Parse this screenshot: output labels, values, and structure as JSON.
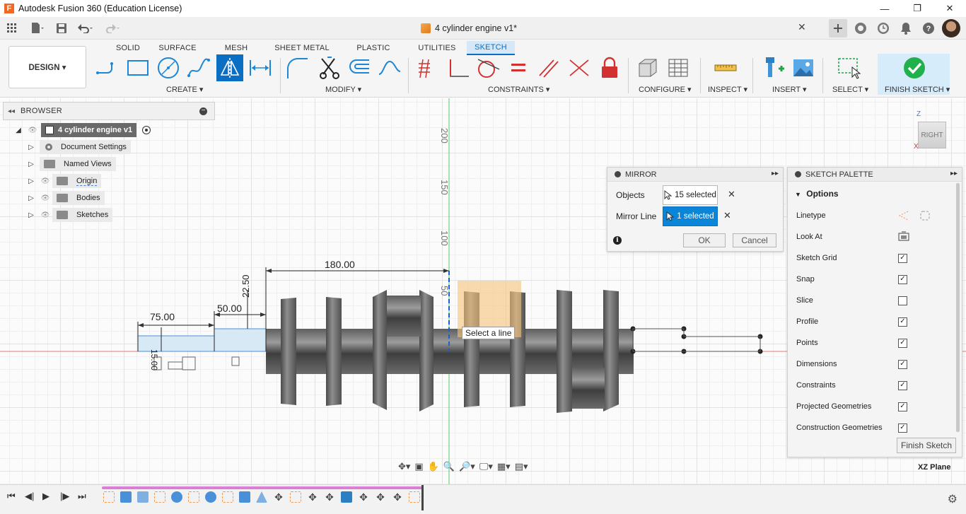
{
  "window": {
    "title": "Autodesk Fusion 360 (Education License)",
    "minimize": "—",
    "restore": "❐",
    "close": "✕"
  },
  "document": {
    "tab_title": "4 cylinder engine v1*",
    "close": "✕"
  },
  "workspace": {
    "design_label": "DESIGN ▾"
  },
  "ribbon": {
    "tabs": [
      {
        "label": "SOLID"
      },
      {
        "label": "SURFACE"
      },
      {
        "label": "MESH"
      },
      {
        "label": "SHEET METAL"
      },
      {
        "label": "PLASTIC"
      },
      {
        "label": "UTILITIES"
      },
      {
        "label": "SKETCH",
        "active": true
      }
    ],
    "groups": {
      "create": "CREATE ▾",
      "modify": "MODIFY ▾",
      "constraints": "CONSTRAINTS ▾",
      "configure": "CONFIGURE ▾",
      "inspect": "INSPECT ▾",
      "insert": "INSERT ▾",
      "select": "SELECT ▾",
      "finish_sketch": "FINISH SKETCH ▾"
    }
  },
  "browser": {
    "title": "BROWSER",
    "root": "4 cylinder engine v1",
    "items": [
      {
        "label": "Document Settings",
        "icon": "gear-icon"
      },
      {
        "label": "Named Views",
        "icon": "folder-icon"
      },
      {
        "label": "Origin",
        "icon": "folder-icon"
      },
      {
        "label": "Bodies",
        "icon": "folder-icon"
      },
      {
        "label": "Sketches",
        "icon": "folder-icon"
      }
    ]
  },
  "sketch": {
    "dimensions": {
      "d180": "180.00",
      "d75": "75.00",
      "d50": "50.00",
      "d22": "22.50",
      "d15": "15.00",
      "d200": "200",
      "d150": "150",
      "d100": "100",
      "d50v": "50"
    },
    "tooltip": "Select a line"
  },
  "mirror": {
    "title": "MIRROR",
    "objects_label": "Objects",
    "objects_value": "15 selected",
    "mirror_line_label": "Mirror Line",
    "mirror_line_value": "1 selected",
    "ok": "OK",
    "cancel": "Cancel"
  },
  "palette": {
    "title": "SKETCH PALETTE",
    "section": "Options",
    "rows": [
      {
        "label": "Linetype",
        "type": "icons"
      },
      {
        "label": "Look At",
        "type": "icon"
      },
      {
        "label": "Sketch Grid",
        "checked": true
      },
      {
        "label": "Snap",
        "checked": true
      },
      {
        "label": "Slice",
        "checked": false
      },
      {
        "label": "Profile",
        "checked": true
      },
      {
        "label": "Points",
        "checked": true
      },
      {
        "label": "Dimensions",
        "checked": true
      },
      {
        "label": "Constraints",
        "checked": true
      },
      {
        "label": "Projected Geometries",
        "checked": true
      },
      {
        "label": "Construction Geometries",
        "checked": true
      }
    ],
    "finish_button": "Finish Sketch"
  },
  "viewcube": {
    "face": "RIGHT",
    "z": "Z",
    "x": "X"
  },
  "status": {
    "plane": "XZ Plane"
  },
  "colors": {
    "accent": "#0a6fc2",
    "finish_green": "#21b04b",
    "timeline": "#d97fd6",
    "mirror_highlight": "#f6c27a"
  }
}
